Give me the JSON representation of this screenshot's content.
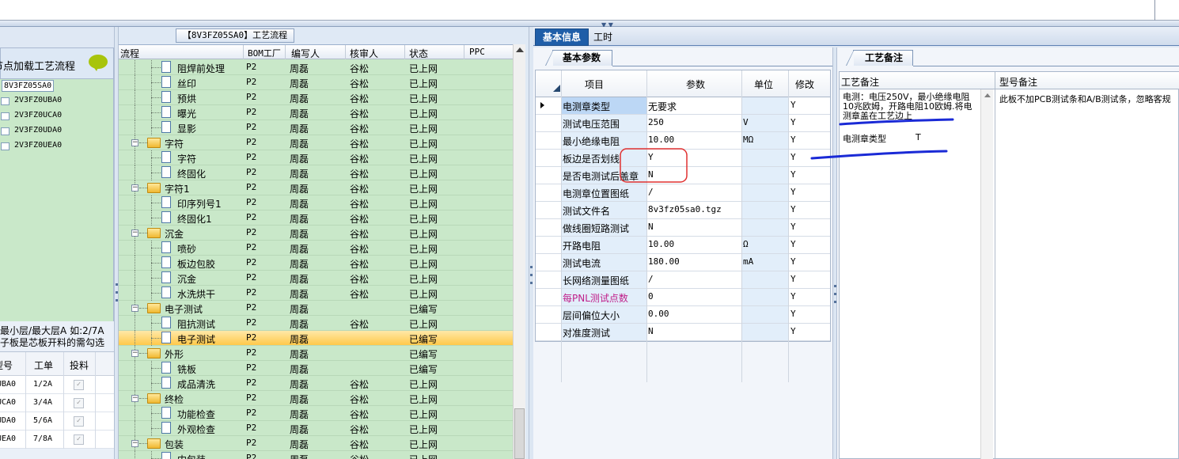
{
  "left": {
    "header_text": "节点加载工艺流程",
    "tree_root": "8V3FZ05SA0",
    "tree_items": [
      "2V3FZ0UBA0",
      "2V3FZ0UCA0",
      "2V3FZ0UDA0",
      "2V3FZ0UEA0"
    ],
    "note_line1": "最小层/最大层A 如:2/7A",
    "note_line2": "子板是芯板开料的需勾选",
    "grid_headers": [
      "型号",
      "工单",
      "投料"
    ],
    "grid_rows": [
      {
        "model": "UBA0",
        "order": "1/2A"
      },
      {
        "model": "UCA0",
        "order": "3/4A"
      },
      {
        "model": "UDA0",
        "order": "5/6A"
      },
      {
        "model": "UEA0",
        "order": "7/8A"
      }
    ]
  },
  "middle": {
    "title": "【8V3FZ05SA0】工艺流程",
    "columns": [
      "流程",
      "BOM工厂",
      "编写人",
      "核审人",
      "状态",
      "PPC"
    ],
    "rows": [
      {
        "level": 2,
        "type": "doc",
        "name": "阻焊前处理",
        "bom": "P2",
        "writer": "周磊",
        "reviewer": "谷松",
        "status": "已上网"
      },
      {
        "level": 2,
        "type": "doc",
        "name": "丝印",
        "bom": "P2",
        "writer": "周磊",
        "reviewer": "谷松",
        "status": "已上网"
      },
      {
        "level": 2,
        "type": "doc",
        "name": "预烘",
        "bom": "P2",
        "writer": "周磊",
        "reviewer": "谷松",
        "status": "已上网"
      },
      {
        "level": 2,
        "type": "doc",
        "name": "曝光",
        "bom": "P2",
        "writer": "周磊",
        "reviewer": "谷松",
        "status": "已上网"
      },
      {
        "level": 2,
        "type": "doc",
        "name": "显影",
        "bom": "P2",
        "writer": "周磊",
        "reviewer": "谷松",
        "status": "已上网"
      },
      {
        "level": 1,
        "type": "folder",
        "name": "字符",
        "bom": "P2",
        "writer": "周磊",
        "reviewer": "谷松",
        "status": "已上网"
      },
      {
        "level": 2,
        "type": "doc",
        "name": "字符",
        "bom": "P2",
        "writer": "周磊",
        "reviewer": "谷松",
        "status": "已上网"
      },
      {
        "level": 2,
        "type": "doc",
        "name": "终固化",
        "bom": "P2",
        "writer": "周磊",
        "reviewer": "谷松",
        "status": "已上网"
      },
      {
        "level": 1,
        "type": "folder",
        "name": "字符1",
        "bom": "P2",
        "writer": "周磊",
        "reviewer": "谷松",
        "status": "已上网"
      },
      {
        "level": 2,
        "type": "doc",
        "name": "印序列号1",
        "bom": "P2",
        "writer": "周磊",
        "reviewer": "谷松",
        "status": "已上网"
      },
      {
        "level": 2,
        "type": "doc",
        "name": "终固化1",
        "bom": "P2",
        "writer": "周磊",
        "reviewer": "谷松",
        "status": "已上网"
      },
      {
        "level": 1,
        "type": "folder",
        "name": "沉金",
        "bom": "P2",
        "writer": "周磊",
        "reviewer": "谷松",
        "status": "已上网"
      },
      {
        "level": 2,
        "type": "doc",
        "name": "喷砂",
        "bom": "P2",
        "writer": "周磊",
        "reviewer": "谷松",
        "status": "已上网"
      },
      {
        "level": 2,
        "type": "doc",
        "name": "板边包胶",
        "bom": "P2",
        "writer": "周磊",
        "reviewer": "谷松",
        "status": "已上网"
      },
      {
        "level": 2,
        "type": "doc",
        "name": "沉金",
        "bom": "P2",
        "writer": "周磊",
        "reviewer": "谷松",
        "status": "已上网"
      },
      {
        "level": 2,
        "type": "doc",
        "name": "水洗烘干",
        "bom": "P2",
        "writer": "周磊",
        "reviewer": "谷松",
        "status": "已上网"
      },
      {
        "level": 1,
        "type": "folder",
        "name": "电子测试",
        "bom": "P2",
        "writer": "周磊",
        "reviewer": "",
        "status": "已编写"
      },
      {
        "level": 2,
        "type": "doc",
        "name": "阻抗测试",
        "bom": "P2",
        "writer": "周磊",
        "reviewer": "谷松",
        "status": "已上网"
      },
      {
        "level": 2,
        "type": "doc",
        "name": "电子测试",
        "bom": "P2",
        "writer": "周磊",
        "reviewer": "",
        "status": "已编写",
        "selected": true
      },
      {
        "level": 1,
        "type": "folder",
        "name": "外形",
        "bom": "P2",
        "writer": "周磊",
        "reviewer": "",
        "status": "已编写"
      },
      {
        "level": 2,
        "type": "doc",
        "name": "铣板",
        "bom": "P2",
        "writer": "周磊",
        "reviewer": "",
        "status": "已编写"
      },
      {
        "level": 2,
        "type": "doc",
        "name": "成品清洗",
        "bom": "P2",
        "writer": "周磊",
        "reviewer": "谷松",
        "status": "已上网"
      },
      {
        "level": 1,
        "type": "folder",
        "name": "终检",
        "bom": "P2",
        "writer": "周磊",
        "reviewer": "谷松",
        "status": "已上网"
      },
      {
        "level": 2,
        "type": "doc",
        "name": "功能检查",
        "bom": "P2",
        "writer": "周磊",
        "reviewer": "谷松",
        "status": "已上网"
      },
      {
        "level": 2,
        "type": "doc",
        "name": "外观检查",
        "bom": "P2",
        "writer": "周磊",
        "reviewer": "谷松",
        "status": "已上网"
      },
      {
        "level": 1,
        "type": "folder",
        "name": "包装",
        "bom": "P2",
        "writer": "周磊",
        "reviewer": "谷松",
        "status": "已上网"
      },
      {
        "level": 2,
        "type": "doc",
        "name": "内包装",
        "bom": "P2",
        "writer": "周磊",
        "reviewer": "谷松",
        "status": "已上网"
      }
    ]
  },
  "right": {
    "tabs": [
      "基本信息",
      "工时"
    ],
    "subtab_params": "基本参数",
    "subtab_memo": "工艺备注",
    "param_columns": [
      "项目",
      "参数",
      "单位",
      "修改"
    ],
    "params": [
      {
        "name": "电测章类型",
        "value": "无要求",
        "unit": "",
        "mod": "Y"
      },
      {
        "name": "测试电压范围",
        "value": "250",
        "unit": "V",
        "mod": "Y"
      },
      {
        "name": "最小绝缘电阻",
        "value": "10.00",
        "unit": "MΩ",
        "mod": "Y"
      },
      {
        "name": "板边是否划线",
        "value": "Y",
        "unit": "",
        "mod": "Y"
      },
      {
        "name": "是否电测试后盖章",
        "value": "N",
        "unit": "",
        "mod": "Y"
      },
      {
        "name": "电测章位置图纸",
        "value": "/",
        "unit": "",
        "mod": "Y"
      },
      {
        "name": "测试文件名",
        "value": "8v3fz05sa0.tgz",
        "unit": "",
        "mod": "Y"
      },
      {
        "name": "做线圈短路测试",
        "value": "N",
        "unit": "",
        "mod": "Y"
      },
      {
        "name": "开路电阻",
        "value": "10.00",
        "unit": "Ω",
        "mod": "Y"
      },
      {
        "name": "测试电流",
        "value": "180.00",
        "unit": "mA",
        "mod": "Y"
      },
      {
        "name": "长网络测量图纸",
        "value": "/",
        "unit": "",
        "mod": "Y"
      },
      {
        "name": "每PNL测试点数",
        "value": "0",
        "unit": "",
        "mod": "Y",
        "highlight": true
      },
      {
        "name": "层间偏位大小",
        "value": "0.00",
        "unit": "",
        "mod": "Y"
      },
      {
        "name": "对准度测试",
        "value": "N",
        "unit": "",
        "mod": "Y"
      }
    ],
    "memo_columns": [
      "工艺备注",
      "型号备注"
    ],
    "memo_text": "电测：电压250V，最小绝缘电阻10兆欧姆，开路电阻10欧姆.将电测章盖在工艺边上",
    "memo_type_label": "电测章类型",
    "memo_type_value": "T",
    "model_memo": "此板不加PCB测试条和A/B测试条，忽略客规"
  },
  "colors": {
    "tree_bg": "#c9e8c9",
    "tab_active": "#1f5ea8",
    "selected_row": "#ffc94a",
    "annotation_red": "#e03030",
    "annotation_blue": "#1a2ad6"
  }
}
